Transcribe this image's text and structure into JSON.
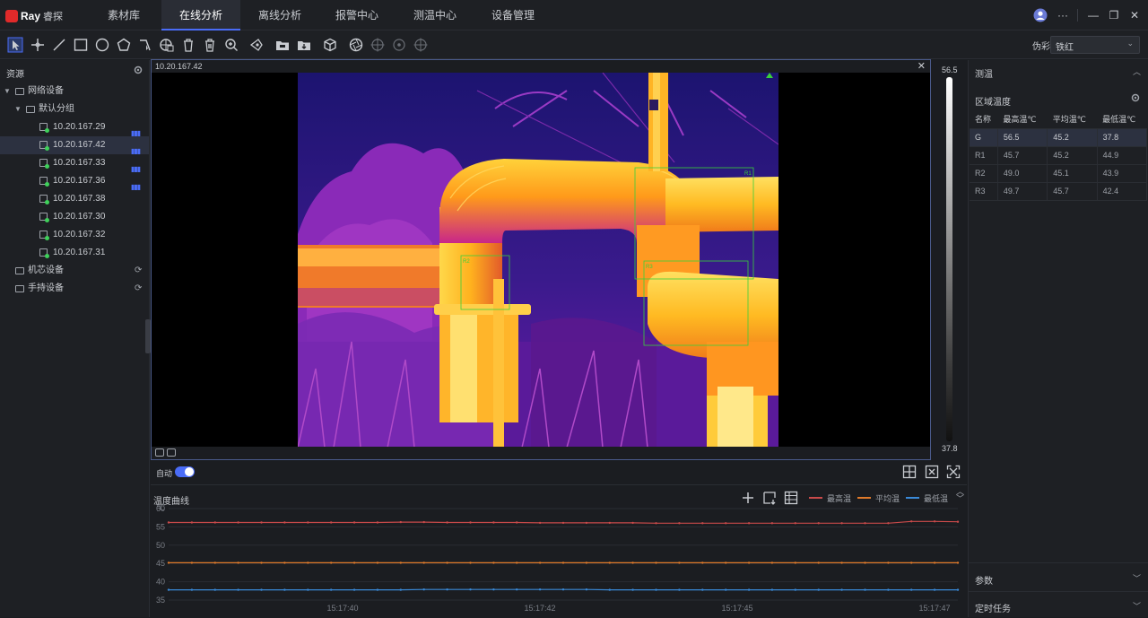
{
  "app": {
    "brand": "Ray",
    "name": "睿探"
  },
  "nav": {
    "tabs": [
      {
        "label": "素材库"
      },
      {
        "label": "在线分析"
      },
      {
        "label": "离线分析"
      },
      {
        "label": "报警中心"
      },
      {
        "label": "测温中心"
      },
      {
        "label": "设备管理"
      }
    ],
    "active_index": 1
  },
  "window": {
    "more": "···",
    "minimize": "—",
    "restore": "❐",
    "close": "✕"
  },
  "toolbar": {
    "pseudo_label": "伪彩",
    "pseudo_value": "铁红"
  },
  "left": {
    "title": "资源",
    "tree": [
      {
        "label": "网络设备",
        "level": 0,
        "kind": "folder",
        "caret": "▼"
      },
      {
        "label": "默认分组",
        "level": 1,
        "kind": "folder",
        "caret": "▼"
      },
      {
        "label": "10.20.167.29",
        "level": 2,
        "kind": "device",
        "signal": true
      },
      {
        "label": "10.20.167.42",
        "level": 2,
        "kind": "device",
        "signal": true,
        "selected": true
      },
      {
        "label": "10.20.167.33",
        "level": 2,
        "kind": "device",
        "signal": true
      },
      {
        "label": "10.20.167.36",
        "level": 2,
        "kind": "device",
        "signal": true
      },
      {
        "label": "10.20.167.38",
        "level": 2,
        "kind": "device"
      },
      {
        "label": "10.20.167.30",
        "level": 2,
        "kind": "device"
      },
      {
        "label": "10.20.167.32",
        "level": 2,
        "kind": "device"
      },
      {
        "label": "10.20.167.31",
        "level": 2,
        "kind": "device"
      },
      {
        "label": "机芯设备",
        "level": 0,
        "kind": "folder",
        "refresh": true
      },
      {
        "label": "手持设备",
        "level": 0,
        "kind": "folder",
        "refresh": true
      }
    ]
  },
  "viewer": {
    "title": "10.20.167.42",
    "close": "✕",
    "scale_max": "56.5",
    "scale_min": "37.8",
    "regions": [
      "R1",
      "R2",
      "R3"
    ]
  },
  "controls": {
    "auto_label": "自动",
    "auto_on": true
  },
  "chart_panel": {
    "title": "温度曲线"
  },
  "chart_data": {
    "type": "line",
    "ylabel": "℃",
    "ylim": [
      35,
      60
    ],
    "yticks": [
      60,
      55,
      50,
      45,
      40,
      35
    ],
    "xticks": [
      "15:17:40",
      "15:17:42",
      "15:17:45",
      "15:17:47"
    ],
    "series": [
      {
        "name": "最高温",
        "color": "#c94a4a",
        "values": [
          56.2,
          56.2,
          56.2,
          56.2,
          56.2,
          56.2,
          56.2,
          56.2,
          56.2,
          56.2,
          56.3,
          56.3,
          56.2,
          56.2,
          56.2,
          56.2,
          56.1,
          56.1,
          56.1,
          56.1,
          56.1,
          56.0,
          56.0,
          56.0,
          56.0,
          56.0,
          56.0,
          56.0,
          56.0,
          56.0,
          56.0,
          56.0,
          56.5,
          56.5,
          56.4
        ]
      },
      {
        "name": "平均温",
        "color": "#e07a2a",
        "values": [
          45.2,
          45.2,
          45.2,
          45.2,
          45.2,
          45.2,
          45.2,
          45.2,
          45.2,
          45.2,
          45.2,
          45.2,
          45.2,
          45.2,
          45.2,
          45.2,
          45.2,
          45.2,
          45.2,
          45.2,
          45.2,
          45.2,
          45.2,
          45.2,
          45.2,
          45.2,
          45.2,
          45.2,
          45.2,
          45.2,
          45.2,
          45.2,
          45.2,
          45.2,
          45.2
        ]
      },
      {
        "name": "最低温",
        "color": "#3a8ad8",
        "values": [
          37.8,
          37.8,
          37.8,
          37.8,
          37.8,
          37.8,
          37.8,
          37.8,
          37.8,
          37.8,
          37.8,
          37.9,
          37.9,
          37.9,
          37.9,
          37.9,
          37.9,
          37.9,
          37.9,
          37.8,
          37.8,
          37.8,
          37.8,
          37.8,
          37.8,
          37.8,
          37.8,
          37.8,
          37.8,
          37.8,
          37.8,
          37.8,
          37.8,
          37.8,
          37.8
        ]
      }
    ]
  },
  "right": {
    "measure_title": "测温",
    "region_title": "区域温度",
    "table": {
      "headers": [
        "名称",
        "最高温℃",
        "平均温℃",
        "最低温℃"
      ],
      "rows": [
        [
          "G",
          "56.5",
          "45.2",
          "37.8"
        ],
        [
          "R1",
          "45.7",
          "45.2",
          "44.9"
        ],
        [
          "R2",
          "49.0",
          "45.1",
          "43.9"
        ],
        [
          "R3",
          "49.7",
          "45.7",
          "42.4"
        ]
      ]
    },
    "params_title": "参数",
    "task_title": "定时任务"
  }
}
